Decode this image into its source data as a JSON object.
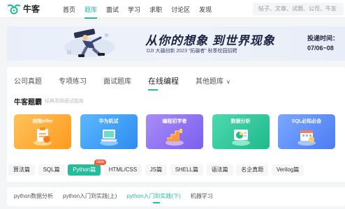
{
  "header": {
    "logo_text": "牛客",
    "nav": [
      "首页",
      "题库",
      "面试",
      "学习",
      "求职",
      "讨论区",
      "发现"
    ],
    "active_nav": 1,
    "search_placeholder": "帖子、文章、试题、公司、牛友"
  },
  "banner": {
    "title": "从你的想象 到世界现象",
    "subtitle": "DJI 大疆创新 2023 “拓疆者” 秋季校园招聘",
    "side_line1": "投递时间：",
    "side_line2": "07/06~08"
  },
  "tabs": {
    "items": [
      "公司真题",
      "专项练习",
      "面试题库",
      "在线编程",
      "其他题库"
    ],
    "active": 3
  },
  "section": {
    "title": "牛客题霸",
    "subtitle": "经典高频面试题库"
  },
  "cards": [
    {
      "label": "剑指offer",
      "color": "#ffab2e",
      "icon": "clipboard-icon"
    },
    {
      "label": "华为机试",
      "color": "#3aa2f6",
      "icon": "laptop-icon"
    },
    {
      "label": "编程初学者",
      "color": "#ff7d3b",
      "icon": "stairs-icon"
    },
    {
      "label": "数据分析",
      "color": "#2fc699",
      "icon": "pie-chart-icon"
    },
    {
      "label": "SQL必知必会",
      "color": "#5a8cf5",
      "icon": "calendar-icon"
    }
  ],
  "langs": {
    "items": [
      "算法篇",
      "SQL篇",
      "Python篇",
      "HTML/CSS",
      "JS篇",
      "SHELL篇",
      "语法篇",
      "名企真题",
      "Verilog篇"
    ],
    "active": 2,
    "badge": "new"
  },
  "subtabs": {
    "items": [
      "python数据分析",
      "python入门到实践(上)",
      "python入门到实践(下)",
      "机器学习"
    ],
    "active": 2
  },
  "colors": {
    "accent": "#25bb9b"
  }
}
